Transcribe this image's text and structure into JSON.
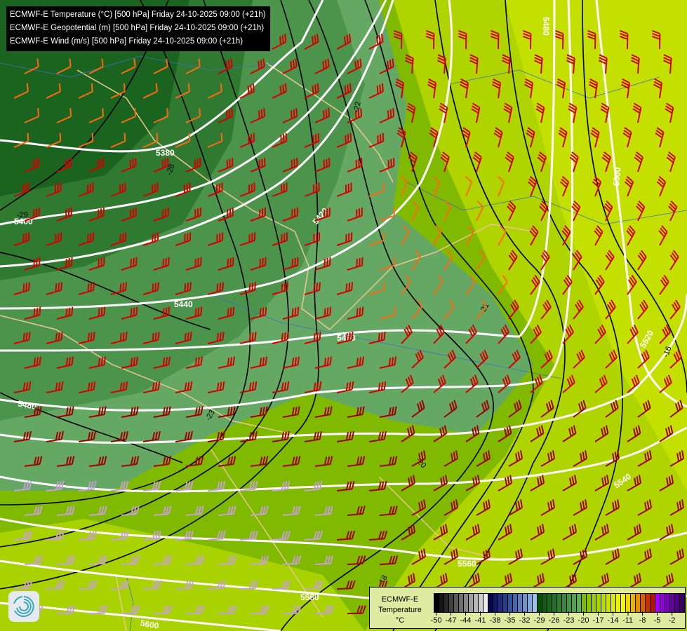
{
  "header": {
    "lines": [
      "ECMWF-E Temperature (°C) [500 hPa] Friday 24-10-2025 09:00 (+21h)",
      "ECMWF-E Geopotential (m) [500 hPa] Friday 24-10-2025 09:00 (+21h)",
      "ECMWF-E Wind (m/s) [500 hPa] Friday 24-10-2025 09:00 (+21h)"
    ]
  },
  "geopotential_labels": [
    "5380",
    "5400",
    "5420",
    "5440",
    "5460",
    "5480",
    "5480",
    "5500",
    "5520",
    "5540",
    "5560",
    "5580",
    "5600"
  ],
  "temperature_labels": [
    "-29",
    "-28",
    "-22",
    "-23",
    "-21",
    "-20",
    "-18",
    "-16"
  ],
  "legend": {
    "title_line1": "ECMWF-E",
    "title_line2": "Temperature",
    "unit": "°C",
    "ticks": [
      "-50",
      "-47",
      "-44",
      "-41",
      "-38",
      "-35",
      "-32",
      "-29",
      "-26",
      "-23",
      "-20",
      "-17",
      "-14",
      "-11",
      "-8",
      "-5",
      "-2"
    ],
    "colors": [
      "#000000",
      "#151515",
      "#2a2a2a",
      "#404040",
      "#5a5a5a",
      "#707070",
      "#888888",
      "#a0a0a0",
      "#b8b8b8",
      "#d0d0d0",
      "#ececec",
      "#06064e",
      "#101a6a",
      "#1c2c7c",
      "#283e8a",
      "#34529a",
      "#4466aa",
      "#5a7ebe",
      "#6c92cc",
      "#80a8dc",
      "#98c4f0",
      "#005400",
      "#0c5e0e",
      "#18681a",
      "#227226",
      "#2e7c30",
      "#3a883c",
      "#469446",
      "#52a052",
      "#5eaa5e",
      "#7cbc00",
      "#8cc400",
      "#9ccc00",
      "#acd400",
      "#bcdc00",
      "#cce400",
      "#dcec00",
      "#ecf400",
      "#f8f800",
      "#f0d800",
      "#e8b800",
      "#e09000",
      "#d86000",
      "#c83000",
      "#b81000",
      "#a800ff",
      "#9200e0",
      "#7c00c0",
      "#6600a0",
      "#500080",
      "#3c0068"
    ]
  },
  "wind_colors": {
    "strong": "#d40000",
    "orange": "#ff6a10",
    "dark": "#a00000",
    "light": "#c8a0d8"
  }
}
